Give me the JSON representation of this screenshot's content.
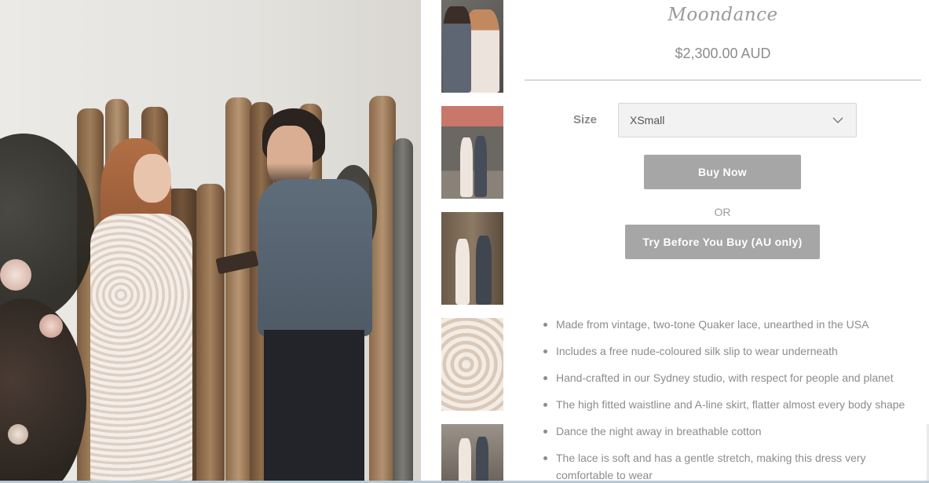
{
  "product": {
    "title": "Moondance",
    "price": "$2,300.00 AUD"
  },
  "size": {
    "label": "Size",
    "selected": "XSmall"
  },
  "buttons": {
    "buy_now": "Buy Now",
    "or": "OR",
    "try_before": "Try Before You Buy (AU only)"
  },
  "features": [
    "Made from vintage, two-tone Quaker lace, unearthed in the USA",
    "Includes a free nude-coloured silk slip to wear underneath",
    "Hand-crafted in our Sydney studio, with respect for people and planet",
    "The high fitted waistline and A-line skirt, flatter almost every body shape",
    "Dance the night away in breathable cotton",
    "The lace is soft and has a gentle stretch, making this dress very comfortable to wear"
  ],
  "colors": {
    "button": "#a6a6a6",
    "text": "#8c8c8c",
    "select_bg": "#f2f2f2"
  },
  "icons": {
    "select": "chevron-down-icon",
    "list_bullet": "bullet-icon"
  }
}
